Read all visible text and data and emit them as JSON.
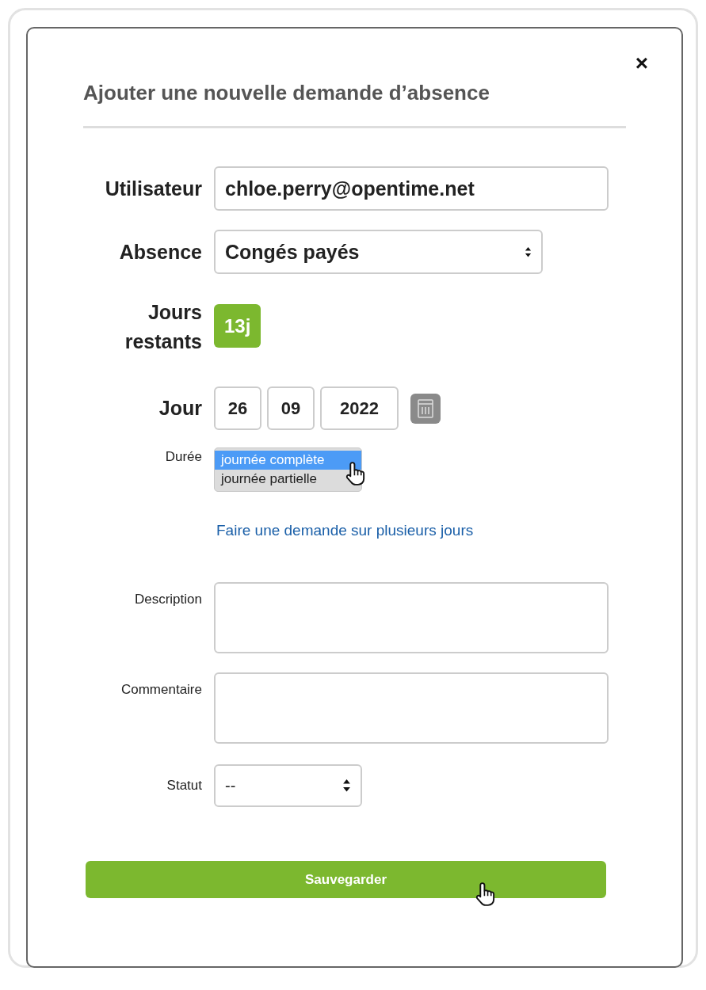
{
  "dialog": {
    "title": "Ajouter une nouvelle demande d’absence",
    "close": "×"
  },
  "user": {
    "label": "Utilisateur",
    "value": "chloe.perry@opentime.net"
  },
  "absence": {
    "label": "Absence",
    "value": "Congés payés"
  },
  "remaining": {
    "label_lines": [
      "Jours",
      "restants"
    ],
    "badge": "13j"
  },
  "day": {
    "label": "Jour",
    "parts": [
      "26",
      "09",
      "2022"
    ]
  },
  "duration": {
    "label": "Durée",
    "options": [
      {
        "label": "journée complète",
        "selected": true
      },
      {
        "label": "journée partielle",
        "selected": false
      }
    ]
  },
  "multi_day_link": "Faire une demande sur plusieurs jours",
  "description": {
    "label": "Description"
  },
  "comment": {
    "label": "Commentaire"
  },
  "status": {
    "label": "Statut",
    "value": "--"
  },
  "save_button": "Sauvegarder"
}
